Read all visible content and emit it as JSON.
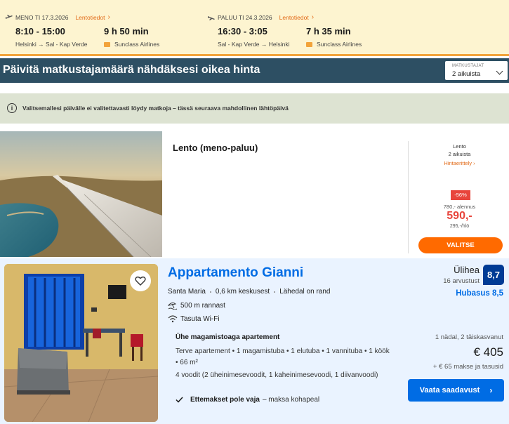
{
  "flights": {
    "outbound": {
      "label": "MENO TI 17.3.2026",
      "details_link": "Lentotiedot",
      "times": "8:10 - 15:00",
      "duration": "9 h 50 min",
      "route": "Helsinki → Sal - Kap Verde",
      "airline": "Sunclass Airlines"
    },
    "return": {
      "label": "PALUU TI 24.3.2026",
      "details_link": "Lentotiedot",
      "times": "16:30 - 3:05",
      "duration": "7 h 35 min",
      "route": "Sal - Kap Verde → Helsinki",
      "airline": "Sunclass Airlines"
    }
  },
  "update_bar": {
    "title": "Päivitä matkustajamäärä nähdäksesi oikea hinta",
    "passengers_label": "MATKUSTAJAT",
    "passengers_value": "2 aikuista"
  },
  "notice": {
    "text": "Valitsemallesi päivälle ei valitettavasti löydy matkoja – tässä seuraava mahdollinen lähtöpäivä"
  },
  "flight_card": {
    "title": "Lento (meno-paluu)",
    "price_type": "Lento",
    "pax": "2 aikuista",
    "price_details_link": "Hintaerittely",
    "discount": "-56%",
    "old_price": "780,- alennus",
    "price": "590,-",
    "per_person": "295,-/hlö",
    "select_label": "VALITSE"
  },
  "hotel": {
    "name": "Appartamento Gianni",
    "location": "Santa Maria",
    "distance_center": "0,6 km keskusest",
    "beach_near": "Lähedal on rand",
    "beach_distance": "500 m rannast",
    "wifi": "Tasuta Wi-Fi",
    "room_title": "Ühe magamistoaga apartement",
    "room_desc": "Terve apartement • 1 magamistuba • 1 elutuba • 1 vannituba • 1 köök • 66 m²",
    "beds": "4 voodit (2 üheinimesevoodit, 1 kaheinimesevoodi, 1 diivanvoodi)",
    "prepay_bold": "Ettemakset pole vaja",
    "prepay_rest": "– maksa kohapeal",
    "rating_word": "Ülihea",
    "review_count": "16 arvustust",
    "score": "8,7",
    "value_score": "Hubasus 8,5",
    "stay_info": "1 nädal, 2 täiskasvanut",
    "price": "€ 405",
    "tax_info": "+ € 65 makse ja tasusid",
    "cta": "Vaata saadavust"
  },
  "colors": {
    "header_bg": "#fdf4d0",
    "accent_orange": "#ff6a00",
    "bar_bg": "#2d4f63",
    "booking_blue": "#006ce4",
    "score_navy": "#003b95",
    "discount_red": "#e8453c"
  }
}
